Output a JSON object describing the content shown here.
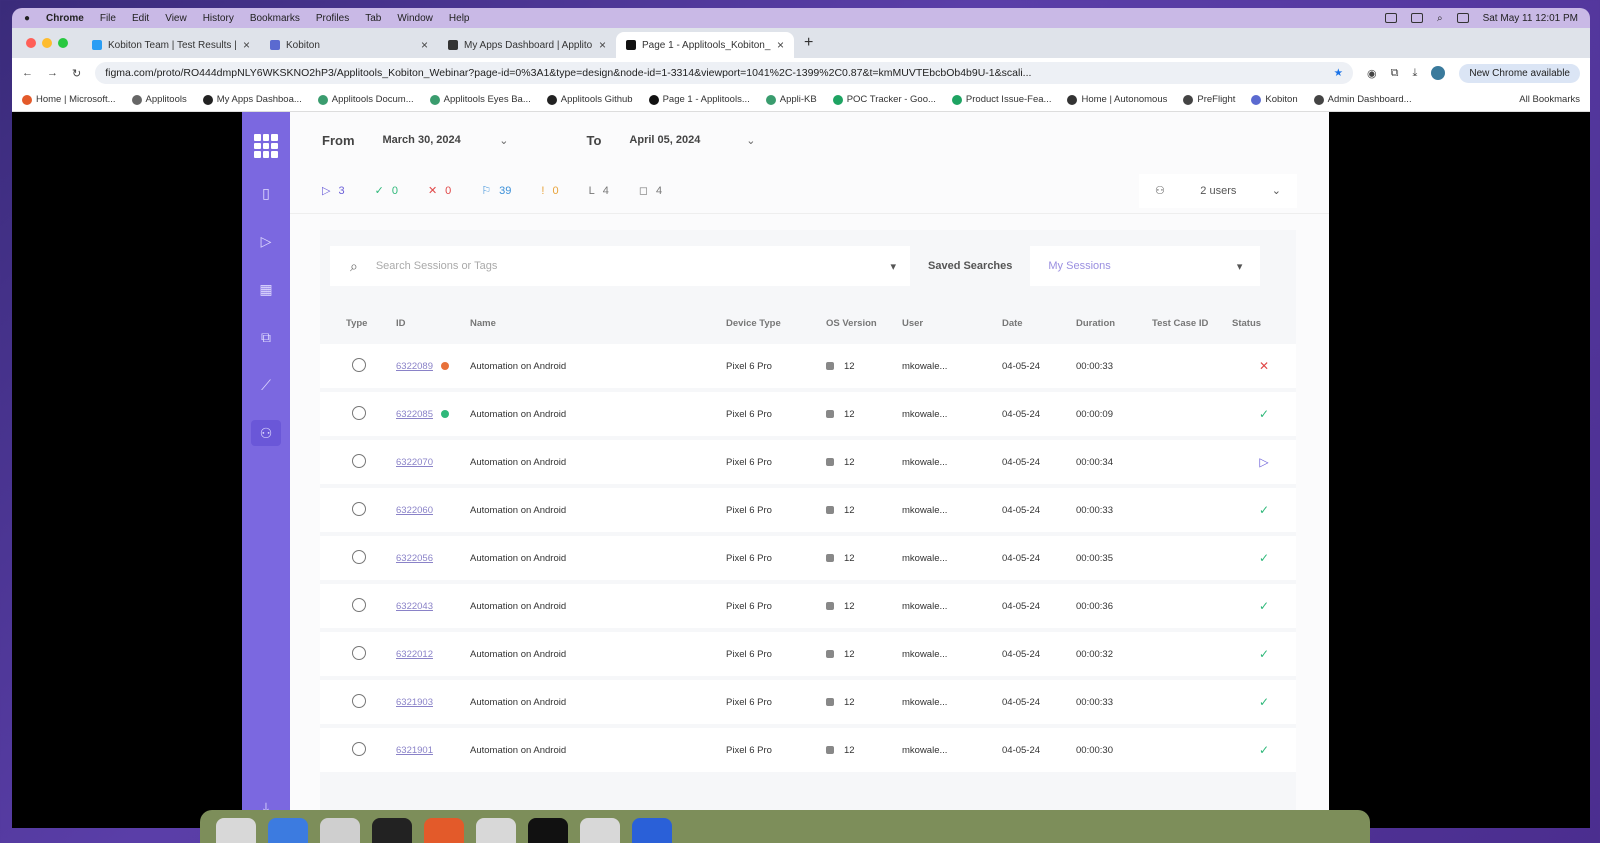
{
  "macbar": {
    "app": "Chrome",
    "menus": [
      "File",
      "Edit",
      "View",
      "History",
      "Bookmarks",
      "Profiles",
      "Tab",
      "Window",
      "Help"
    ],
    "clock": "Sat May 11  12:01 PM"
  },
  "tabs": [
    {
      "title": "Kobiton Team | Test Results |",
      "color": "#2a9df4"
    },
    {
      "title": "Kobiton",
      "color": "#5b6ad0"
    },
    {
      "title": "My Apps Dashboard | Applito",
      "color": "#333333"
    },
    {
      "title": "Page 1 - Applitools_Kobiton_",
      "color": "#111111"
    }
  ],
  "address": {
    "url": "figma.com/proto/RO444dmpNLY6WKSKNO2hP3/Applitools_Kobiton_Webinar?page-id=0%3A1&type=design&node-id=1-3314&viewport=1041%2C-1399%2C0.87&t=kmMUVTEbcbOb4b9U-1&scali...",
    "new_chrome": "New Chrome available"
  },
  "bookmarks": [
    {
      "label": "Home | Microsoft...",
      "color": "#e35a2a"
    },
    {
      "label": "Applitools",
      "color": "#666666"
    },
    {
      "label": "My Apps Dashboa...",
      "color": "#222222"
    },
    {
      "label": "Applitools Docum...",
      "color": "#3a9c6e"
    },
    {
      "label": "Applitools Eyes Ba...",
      "color": "#3a9c6e"
    },
    {
      "label": "Applitools Github",
      "color": "#222222"
    },
    {
      "label": "Page 1 - Applitools...",
      "color": "#111111"
    },
    {
      "label": "Appli-KB",
      "color": "#3a9c6e"
    },
    {
      "label": "POC Tracker - Goo...",
      "color": "#1ea362"
    },
    {
      "label": "Product Issue-Fea...",
      "color": "#1ea362"
    },
    {
      "label": "Home | Autonomous",
      "color": "#333333"
    },
    {
      "label": "PreFlight",
      "color": "#444444"
    },
    {
      "label": "Kobiton",
      "color": "#5b6ad0"
    },
    {
      "label": "Admin Dashboard...",
      "color": "#444444"
    }
  ],
  "all_bookmarks": "All Bookmarks",
  "dates": {
    "from_label": "From",
    "from_value": "March 30, 2024",
    "to_label": "To",
    "to_value": "April 05, 2024"
  },
  "stats": [
    {
      "icon": "▷",
      "value": "3",
      "color": "#6b5fd8"
    },
    {
      "icon": "✓",
      "value": "0",
      "color": "#2fb87a"
    },
    {
      "icon": "✕",
      "value": "0",
      "color": "#e04848"
    },
    {
      "icon": "⚐",
      "value": "39",
      "color": "#3a8fd8"
    },
    {
      "icon": "!",
      "value": "0",
      "color": "#e8a33a"
    },
    {
      "icon": "L",
      "value": "4",
      "color": "#777777"
    },
    {
      "icon": "◻",
      "value": "4",
      "color": "#777777"
    }
  ],
  "users": "2 users",
  "search": {
    "placeholder": "Search Sessions or Tags",
    "saved_label": "Saved Searches",
    "saved_value": "My Sessions"
  },
  "columns": [
    "Type",
    "ID",
    "Name",
    "Device Type",
    "OS Version",
    "User",
    "Date",
    "Duration",
    "Test Case ID",
    "Status"
  ],
  "rows": [
    {
      "id": "6322089",
      "tag": "#e8713a",
      "name": "Automation on Android",
      "device": "Pixel 6 Pro",
      "os": "12",
      "user": "mkowale...",
      "date": "04-05-24",
      "duration": "00:00:33",
      "status": "✕",
      "status_color": "#e04848"
    },
    {
      "id": "6322085",
      "tag": "#2fb87a",
      "name": "Automation on Android",
      "device": "Pixel 6 Pro",
      "os": "12",
      "user": "mkowale...",
      "date": "04-05-24",
      "duration": "00:00:09",
      "status": "✓",
      "status_color": "#2fb87a"
    },
    {
      "id": "6322070",
      "tag": "",
      "name": "Automation on Android",
      "device": "Pixel 6 Pro",
      "os": "12",
      "user": "mkowale...",
      "date": "04-05-24",
      "duration": "00:00:34",
      "status": "▷",
      "status_color": "#6b5fd8"
    },
    {
      "id": "6322060",
      "tag": "",
      "name": "Automation on Android",
      "device": "Pixel 6 Pro",
      "os": "12",
      "user": "mkowale...",
      "date": "04-05-24",
      "duration": "00:00:33",
      "status": "✓",
      "status_color": "#2fb87a"
    },
    {
      "id": "6322056",
      "tag": "",
      "name": "Automation on Android",
      "device": "Pixel 6 Pro",
      "os": "12",
      "user": "mkowale...",
      "date": "04-05-24",
      "duration": "00:00:35",
      "status": "✓",
      "status_color": "#2fb87a"
    },
    {
      "id": "6322043",
      "tag": "",
      "name": "Automation on Android",
      "device": "Pixel 6 Pro",
      "os": "12",
      "user": "mkowale...",
      "date": "04-05-24",
      "duration": "00:00:36",
      "status": "✓",
      "status_color": "#2fb87a"
    },
    {
      "id": "6322012",
      "tag": "",
      "name": "Automation on Android",
      "device": "Pixel 6 Pro",
      "os": "12",
      "user": "mkowale...",
      "date": "04-05-24",
      "duration": "00:00:32",
      "status": "✓",
      "status_color": "#2fb87a"
    },
    {
      "id": "6321903",
      "tag": "",
      "name": "Automation on Android",
      "device": "Pixel 6 Pro",
      "os": "12",
      "user": "mkowale...",
      "date": "04-05-24",
      "duration": "00:00:33",
      "status": "✓",
      "status_color": "#2fb87a"
    },
    {
      "id": "6321901",
      "tag": "",
      "name": "Automation on Android",
      "device": "Pixel 6 Pro",
      "os": "12",
      "user": "mkowale...",
      "date": "04-05-24",
      "duration": "00:00:30",
      "status": "✓",
      "status_color": "#2fb87a"
    }
  ]
}
